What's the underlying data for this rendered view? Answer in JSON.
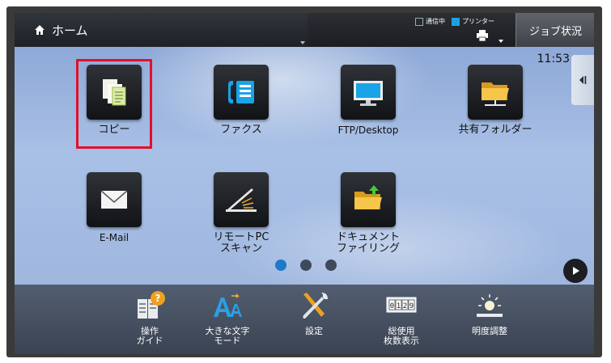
{
  "topbar": {
    "home_label": "ホーム",
    "status_sending": "通信中",
    "status_printer": "プリンター",
    "job_status_button": "ジョブ状況"
  },
  "main": {
    "clock": "11:53",
    "apps": [
      {
        "label": "コピー",
        "icon": "copy-icon"
      },
      {
        "label": "ファクス",
        "icon": "fax-icon"
      },
      {
        "label": "FTP/Desktop",
        "icon": "ftp-desktop-icon"
      },
      {
        "label": "共有フォルダー",
        "icon": "shared-folder-icon"
      },
      {
        "label": "E-Mail",
        "icon": "email-icon"
      },
      {
        "label_line1": "リモートPC",
        "label_line2": "スキャン",
        "icon": "remote-pc-scan-icon"
      },
      {
        "label_line1": "ドキュメント",
        "label_line2": "ファイリング",
        "icon": "document-filing-icon"
      }
    ],
    "page_indicator": {
      "pages": 3,
      "current": 1
    }
  },
  "bottom": {
    "items": [
      {
        "line1": "操作",
        "line2": "ガイド",
        "icon": "operation-guide-icon"
      },
      {
        "line1": "大きな文字",
        "line2": "モード",
        "icon": "large-text-mode-icon"
      },
      {
        "line1": "設定",
        "line2": "",
        "icon": "settings-icon"
      },
      {
        "line1": "総使用",
        "line2": "枚数表示",
        "icon": "counter-icon",
        "counter_digits": "0 1 2 9"
      },
      {
        "line1": "明度調整",
        "line2": "",
        "icon": "brightness-icon"
      }
    ]
  },
  "colors": {
    "highlight": "#e2102a",
    "accent": "#1f78c8",
    "printer_status": "#1fa0e0"
  }
}
